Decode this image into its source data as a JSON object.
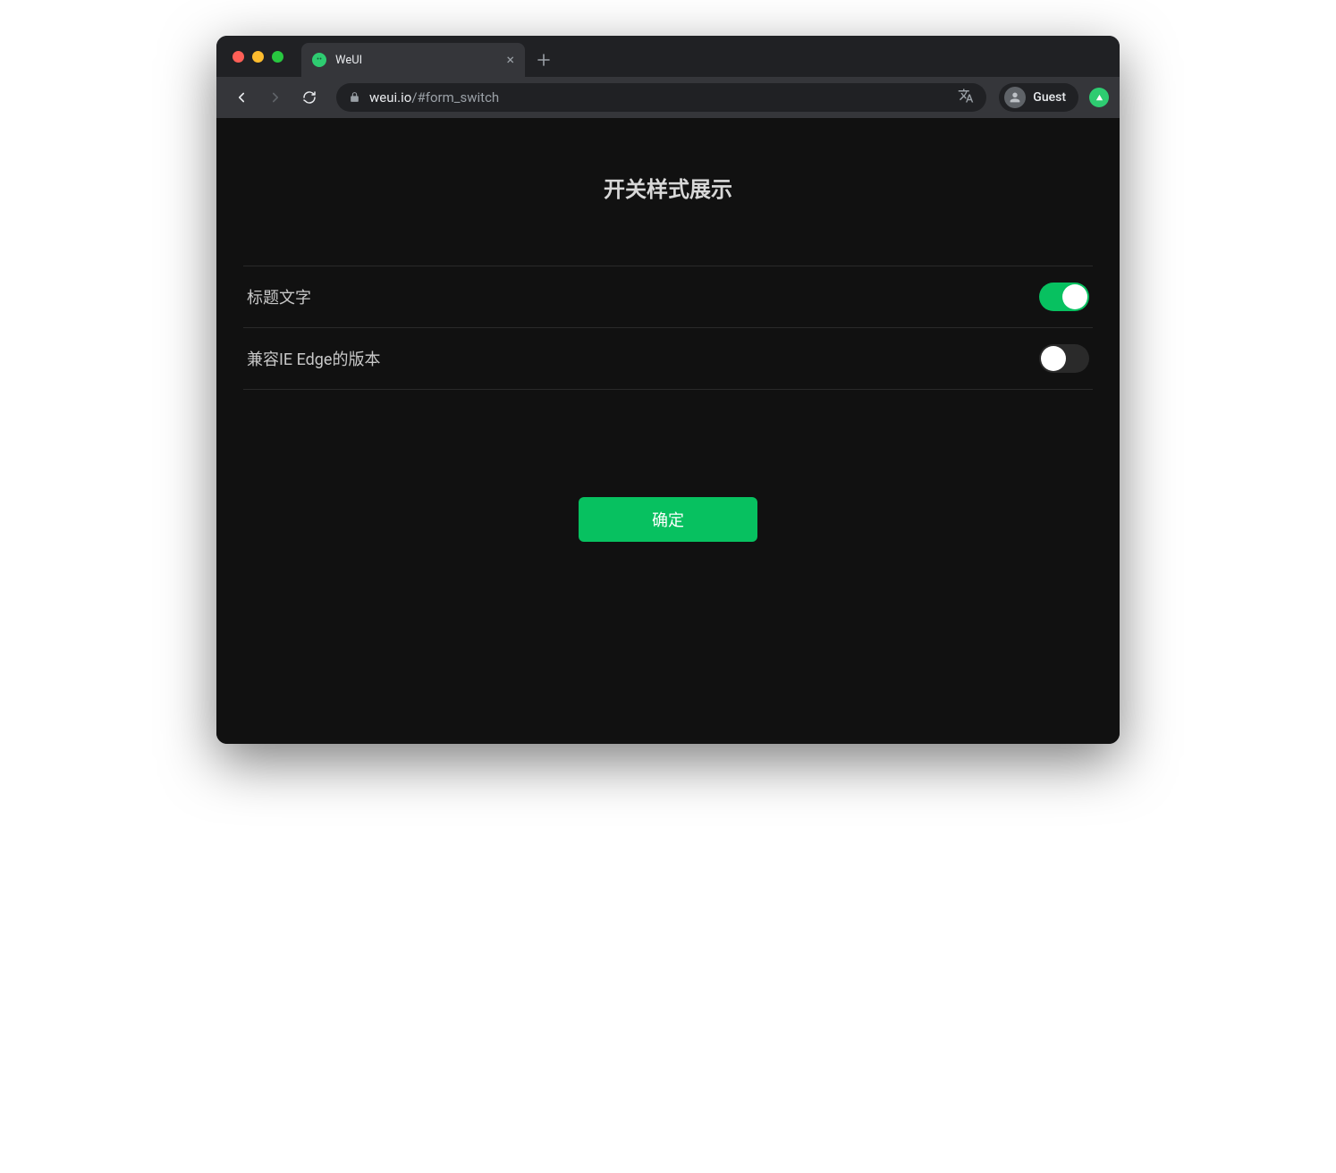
{
  "browser": {
    "tab_title": "WeUI",
    "url_domain": "weui.io",
    "url_path": "/#form_switch",
    "profile_label": "Guest"
  },
  "page": {
    "title": "开关样式展示",
    "switches": [
      {
        "label": "标题文字",
        "on": true
      },
      {
        "label": "兼容IE Edge的版本",
        "on": false
      }
    ],
    "submit_label": "确定"
  },
  "colors": {
    "accent": "#07c160",
    "bg_dark": "#111111"
  }
}
